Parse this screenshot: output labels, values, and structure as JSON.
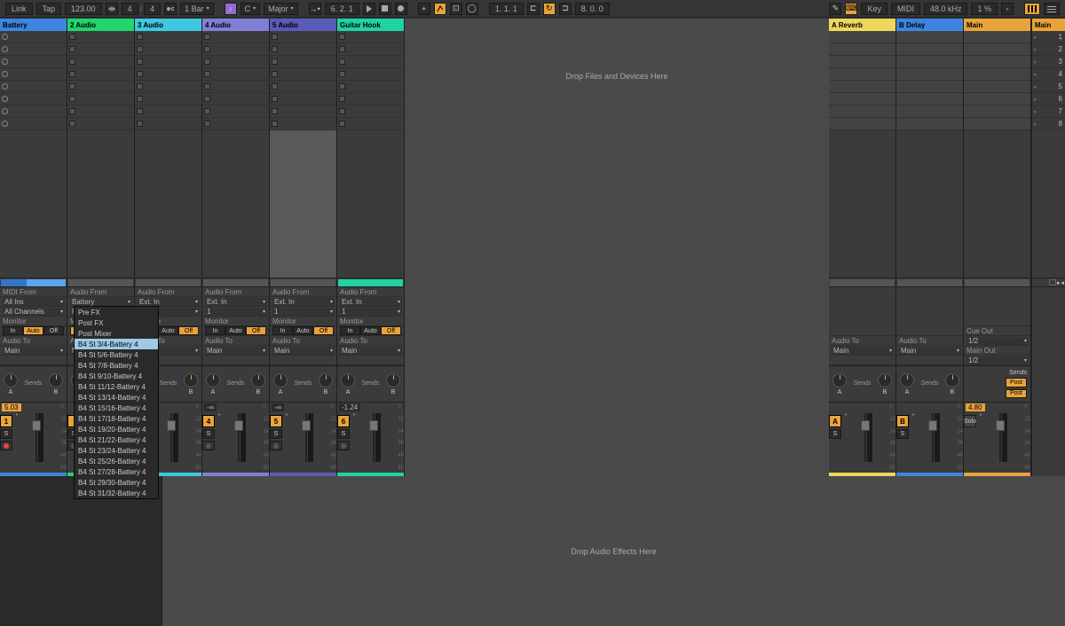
{
  "toolbar": {
    "link": "Link",
    "tap": "Tap",
    "tempo": "123.00",
    "sig_num": "4",
    "sig_den": "4",
    "quant": "1 Bar",
    "root": "C",
    "scale": "Major",
    "pos": "6. 2. 1",
    "arr_pos": "1. 1. 1",
    "punch_end": "8. 0. 0",
    "key": "Key",
    "midi": "MIDI",
    "rate": "48.0 kHz",
    "cpu": "1 %",
    "nudge_down": "◂",
    "nudge_up": "▸"
  },
  "tracks": [
    {
      "name": "Battery",
      "color": "#3d85e0",
      "io_from_label": "MIDI From",
      "io_from": "All Ins",
      "io_sub": "All Channels",
      "mon": "Auto",
      "audio_to": "Main",
      "vol": "5.03",
      "volneg": false,
      "num": "1",
      "armed": true
    },
    {
      "name": "2 Audio",
      "color": "#20d66b",
      "io_from_label": "Audio From",
      "io_from": "Battery",
      "io_sub": "Post Mixer",
      "mon": "In",
      "audio_to": "Main",
      "vol": "",
      "volneg": true,
      "num": "",
      "armed": false
    },
    {
      "name": "3 Audio",
      "color": "#3ec7e0",
      "io_from_label": "Audio From",
      "io_from": "Ext. In",
      "io_sub": "1",
      "mon": "Off",
      "audio_to": "Main",
      "vol": "",
      "volneg": true,
      "num": "",
      "armed": false
    },
    {
      "name": "4 Audio",
      "color": "#7f7fd8",
      "io_from_label": "Audio From",
      "io_from": "Ext. In",
      "io_sub": "1",
      "mon": "Off",
      "audio_to": "Main",
      "vol": "-∞",
      "volneg": true,
      "num": "4",
      "armed": false
    },
    {
      "name": "5 Audio",
      "color": "#5a5ab8",
      "io_from_label": "Audio From",
      "io_from": "Ext. In",
      "io_sub": "1",
      "mon": "Off",
      "audio_to": "Main",
      "vol": "-∞",
      "volneg": true,
      "num": "5",
      "armed": false
    },
    {
      "name": "Guitar Hook",
      "color": "#1fd3a3",
      "io_from_label": "Audio From",
      "io_from": "Ext. In",
      "io_sub": "1",
      "mon": "Off",
      "audio_to": "Main",
      "vol": "-1.24",
      "volneg": true,
      "num": "6",
      "armed": false
    }
  ],
  "returns": [
    {
      "name": "A Reverb",
      "color": "#edd85b",
      "audio_to": "Main",
      "letter": "A"
    },
    {
      "name": "B Delay",
      "color": "#3d85e0",
      "audio_to": "Main",
      "letter": "B"
    }
  ],
  "main": {
    "name": "Main",
    "color": "#e9a33b",
    "cue_label": "Cue Out",
    "cue": "1/2",
    "main_out_label": "Main Out",
    "main_out": "1/2",
    "post": "Post",
    "solo": "Solo",
    "vol": "4.80"
  },
  "drop_files": "Drop Files and Devices Here",
  "drop_fx": "Drop Audio Effects Here",
  "sends_label": "Sends",
  "send_a": "A",
  "send_b": "B",
  "monitor_label": "Monitor",
  "audio_to_label": "Audio To",
  "mon_in": "In",
  "mon_auto": "Auto",
  "mon_off": "Off",
  "s_label": "S",
  "db": {
    "d0": "0",
    "d12": "12",
    "d24": "24",
    "d36": "36",
    "d48": "48",
    "d60": "60"
  },
  "scenes": [
    "1",
    "2",
    "3",
    "4",
    "5",
    "6",
    "7",
    "8"
  ],
  "dropdown": {
    "items": [
      "Pre FX",
      "Post FX",
      "Post Mixer",
      "B4 St 3/4-Battery 4",
      "B4 St 5/6-Battery 4",
      "B4 St 7/8-Battery 4",
      "B4 St 9/10-Battery 4",
      "B4 St 11/12-Battery 4",
      "B4 St 13/14-Battery 4",
      "B4 St 15/16-Battery 4",
      "B4 St 17/18-Battery 4",
      "B4 St 19/20-Battery 4",
      "B4 St 21/22-Battery 4",
      "B4 St 23/24-Battery 4",
      "B4 St 25/26-Battery 4",
      "B4 St 27/28-Battery 4",
      "B4 St 29/30-Battery 4",
      "B4 St 31/32-Battery 4"
    ],
    "selected": 3
  }
}
